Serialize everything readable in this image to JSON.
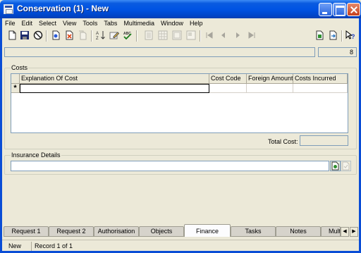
{
  "window": {
    "title": "Conservation (1) - New"
  },
  "menu": [
    "File",
    "Edit",
    "Select",
    "View",
    "Tools",
    "Tabs",
    "Multimedia",
    "Window",
    "Help"
  ],
  "toolbar": {
    "icons": [
      "new-icon",
      "save-icon",
      "cancel-icon",
      "open-record-icon",
      "delete-record-icon",
      "copy-icon",
      "sort-icon",
      "edit-icon",
      "spellcheck-icon",
      "view-1-icon",
      "view-2-icon",
      "view-3-icon",
      "view-4-icon",
      "first-icon",
      "previous-icon",
      "next-icon",
      "last-icon",
      "report-icon",
      "export-icon",
      "help-icon"
    ]
  },
  "record_count": "8",
  "costs": {
    "group_label": "Costs",
    "columns": [
      "Explanation Of Cost",
      "Cost Code",
      "Foreign Amount",
      "Costs Incurred"
    ],
    "new_row_marker": "*",
    "total_label": "Total Cost:"
  },
  "insurance": {
    "group_label": "Insurance Details"
  },
  "tabs": [
    "Request 1",
    "Request 2",
    "Authorisation",
    "Objects",
    "Finance",
    "Tasks",
    "Notes",
    "Multi"
  ],
  "selected_tab": "Finance",
  "status": {
    "mode": "New",
    "record": "Record 1 of 1"
  }
}
